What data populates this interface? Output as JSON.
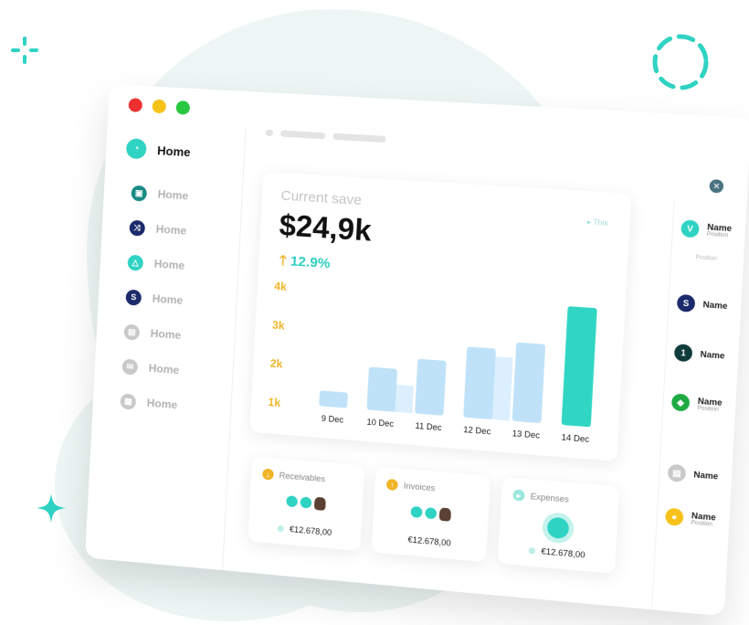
{
  "colors": {
    "teal": "#2fd3c3",
    "orange": "#f0b428",
    "navy": "#1b2a6b",
    "bar_light": "#bfe2f8",
    "bar_teal": "#30d6c3"
  },
  "sidebar": {
    "brand_label": "Home",
    "items": [
      {
        "label": "Home",
        "icon": "teal-square-icon",
        "color": "#1a8a86",
        "glyph": "▣"
      },
      {
        "label": "Home",
        "icon": "shuffle-icon",
        "color": "#1b2a6b",
        "glyph": "⤨"
      },
      {
        "label": "Home",
        "icon": "teal-triangle-icon",
        "color": "#2fd3c3",
        "glyph": "△"
      },
      {
        "label": "Home",
        "icon": "s-icon",
        "color": "#1b2a6b",
        "glyph": "S"
      },
      {
        "label": "Home",
        "icon": "doc-icon",
        "color": "#c9c9c9",
        "glyph": "▤"
      },
      {
        "label": "Home",
        "icon": "mail-icon",
        "color": "#c9c9c9",
        "glyph": "✉"
      },
      {
        "label": "Home",
        "icon": "folder-icon",
        "color": "#c9c9c9",
        "glyph": "▦"
      }
    ]
  },
  "main": {
    "title": "Current save",
    "value": "$24,9k",
    "delta": "12.9%",
    "this_tag": "This"
  },
  "chart_data": {
    "type": "bar",
    "categories": [
      "9 Dec",
      "10 Dec",
      "11 Dec",
      "12 Dec",
      "13 Dec",
      "14 Dec"
    ],
    "series": [
      {
        "values": [
          1.4,
          2.1,
          2.4,
          2.8,
          3.0,
          4.0
        ]
      }
    ],
    "secondary_values": [
      null,
      1.7,
      null,
      2.6,
      null,
      null
    ],
    "y_ticks": [
      "1k",
      "2k",
      "3k",
      "4k"
    ],
    "ylim": [
      1,
      4.3
    ]
  },
  "cards": [
    {
      "title": "Receivables",
      "amount": "€12.678,00",
      "icon_color": "#f0b428",
      "arrow": "↓"
    },
    {
      "title": "Invoices",
      "amount": "€12.678,00",
      "icon_color": "#f0b428",
      "arrow": "↑"
    },
    {
      "title": "Expenses",
      "amount": "€12.678,00",
      "icon_color": "#9ae7de",
      "arrow": "▸"
    }
  ],
  "people": [
    {
      "name": "Name",
      "position": "Position",
      "initial": "V",
      "color": "#2fd3c3"
    },
    {
      "name": "Name",
      "initial": "S",
      "color": "#1b2a6b"
    },
    {
      "name": "Name",
      "initial": "1",
      "color": "#0f3b3a"
    },
    {
      "name": "Name",
      "position": "Position",
      "initial": "◆",
      "color": "#1faa44"
    },
    {
      "name": "Name",
      "initial": "▤",
      "color": "#c9c9c9"
    },
    {
      "name": "Name",
      "position": "Position",
      "initial": "●",
      "color": "#f6c21a"
    }
  ],
  "right_extra": {
    "position_small": "Position"
  }
}
